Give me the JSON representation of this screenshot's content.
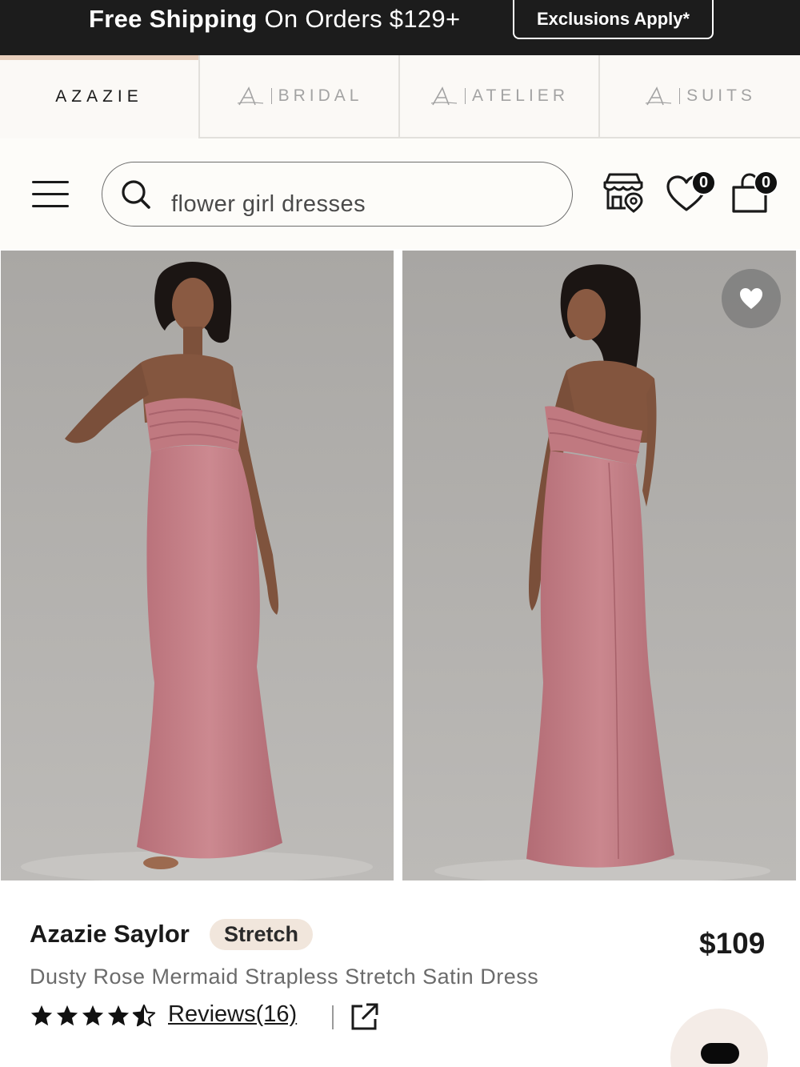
{
  "promo": {
    "bold_text": "Free Shipping",
    "rest_text": " On Orders $129+",
    "exclusions_label": "Exclusions Apply*"
  },
  "brand_tabs": [
    {
      "label": "AZAZIE",
      "active": true
    },
    {
      "label": "BRIDAL",
      "active": false
    },
    {
      "label": "ATELIER",
      "active": false
    },
    {
      "label": "SUITS",
      "active": false
    }
  ],
  "header": {
    "search_value": "flower girl dresses",
    "wishlist_count": "0",
    "cart_count": "0"
  },
  "product": {
    "brand_name": "Azazie Saylor",
    "tag": "Stretch",
    "description": "Dusty Rose Mermaid Strapless Stretch Satin Dress",
    "price": "$109",
    "rating": 4.5,
    "reviews_label": "Reviews(16)",
    "dress_color": "#c57f86"
  },
  "icons": {
    "menu": "hamburger-icon",
    "search": "search-icon",
    "store": "store-locator-icon",
    "wishlist": "heart-icon",
    "cart": "shopping-bag-icon",
    "favorite": "heart-filled-icon",
    "share": "external-link-icon"
  },
  "colors": {
    "promo_bg": "#1c1c1c",
    "accent": "#e8cfbd",
    "chip_bg": "#f1e6dc"
  }
}
